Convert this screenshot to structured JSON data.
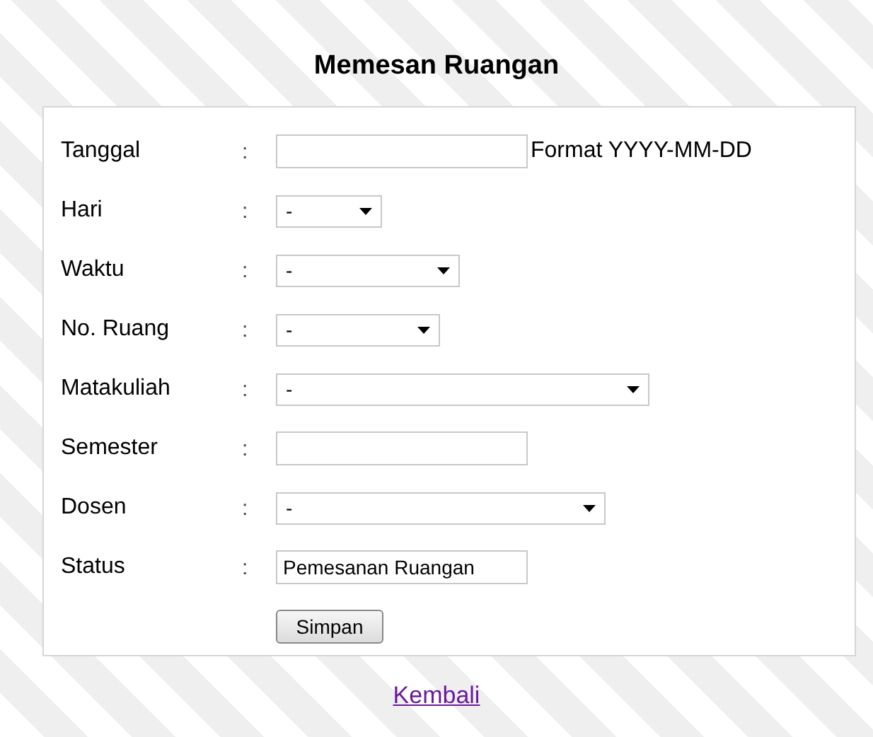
{
  "title": "Memesan Ruangan",
  "fields": [
    {
      "label": "Tanggal",
      "separator": ":",
      "kind": "text",
      "hint": "Format YYYY-MM-DD"
    },
    {
      "label": "Hari",
      "separator": ":",
      "kind": "select",
      "value": "-"
    },
    {
      "label": "Waktu",
      "separator": ":",
      "kind": "select",
      "value": "-"
    },
    {
      "label": "No. Ruang",
      "separator": ":",
      "kind": "select",
      "value": "-"
    },
    {
      "label": "Matakuliah",
      "separator": ":",
      "kind": "select",
      "value": "-"
    },
    {
      "label": "Semester",
      "separator": ":",
      "kind": "text"
    },
    {
      "label": "Dosen",
      "separator": ":",
      "kind": "select",
      "value": "-"
    },
    {
      "label": "Status",
      "separator": ":",
      "kind": "text",
      "value": "Pemesanan Ruangan"
    }
  ],
  "submit": "Simpan",
  "back_link": "Kembali"
}
